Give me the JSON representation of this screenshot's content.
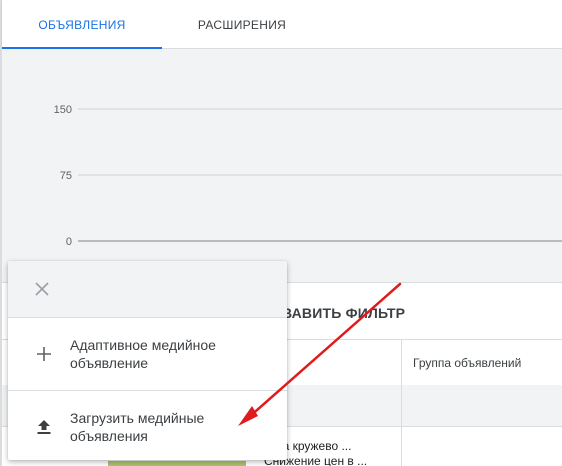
{
  "tabs": [
    {
      "label": "ОБЪЯВЛЕНИЯ",
      "active": true
    },
    {
      "label": "РАСШИРЕНИЯ",
      "active": false
    }
  ],
  "chart_data": {
    "type": "line",
    "yticks": [
      150,
      75,
      0
    ],
    "ylim": [
      0,
      150
    ],
    "series": [],
    "grid": true
  },
  "filter": {
    "label": "ВАВИТЬ ФИЛЬТР"
  },
  "table": {
    "columns": [
      "Группа объявлений"
    ],
    "row": {
      "text_line1": "ы на кружево ...",
      "text_line2": "Снижение цен в ..."
    }
  },
  "menu": {
    "close_icon": "close-icon",
    "items": [
      {
        "icon": "plus-icon",
        "label": "Адаптивное медийное объявление"
      },
      {
        "icon": "upload-icon",
        "label": "Загрузить медийные объявления"
      }
    ]
  },
  "colors": {
    "accent": "#1a73e8",
    "annotation_arrow": "#e01b1b",
    "chart_bg": "#f1f3f4"
  }
}
